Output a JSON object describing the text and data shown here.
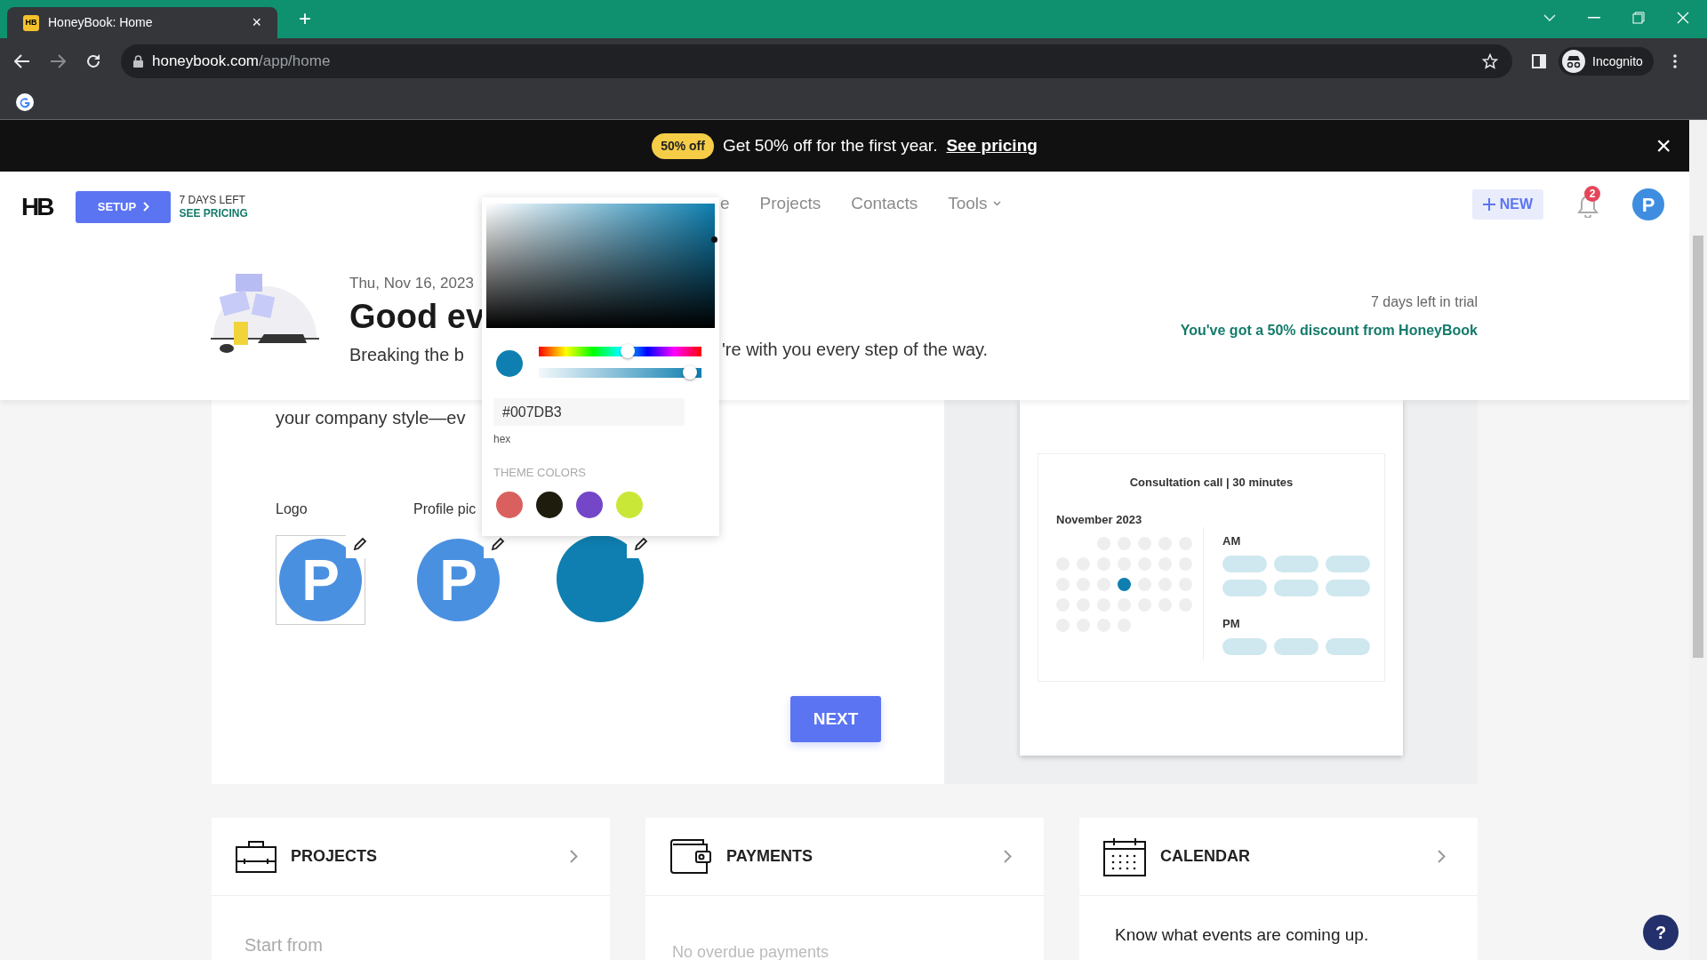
{
  "browser": {
    "favicon": "HB",
    "tab_title": "HoneyBook: Home",
    "tab_close": "×",
    "new_tab": "+",
    "url_domain": "honeybook.com",
    "url_path": "/app/home",
    "profile": "Incognito"
  },
  "promo_banner": {
    "badge": "50% off",
    "text": "Get 50% off for the first year.",
    "link": "See pricing",
    "close": "×"
  },
  "header": {
    "logo": "HB",
    "setup_button": "SETUP",
    "trial_days": "7 DAYS LEFT",
    "see_pricing": "SEE PRICING",
    "nav": [
      {
        "label": "e",
        "dropdown": false
      },
      {
        "label": "Projects",
        "dropdown": false
      },
      {
        "label": "Contacts",
        "dropdown": false
      },
      {
        "label": "Tools",
        "dropdown": true
      }
    ],
    "new_button": "NEW",
    "notification_count": "2",
    "avatar": "P"
  },
  "hero": {
    "date": "Thu, Nov 16, 2023",
    "greeting": "Good ev",
    "subtitle_start": "Breaking the b",
    "subtitle_end": "'re with you every step of the way.",
    "trial_note": "7 days left in trial",
    "discount": "You've got a 50% discount from HoneyBook"
  },
  "branding": {
    "intro": "your company style—ev",
    "next_button": "NEXT",
    "items": [
      {
        "kind": "image",
        "label": "Logo",
        "initial": "P"
      },
      {
        "kind": "image",
        "label": "Profile pic",
        "initial": "P"
      },
      {
        "kind": "color",
        "color": "#0e7fb0"
      }
    ]
  },
  "color_picker": {
    "preview": {
      "color": "#0e7fb0"
    },
    "hex": "#007DB3",
    "hex_label": "hex",
    "theme_title": "THEME COLORS",
    "sliders": [
      {
        "kind": "hue",
        "level": 0.55
      },
      {
        "kind": "alpha",
        "level": 0.97
      }
    ],
    "theme_colors": [
      {
        "color": "#d9605f"
      },
      {
        "color": "#1e1d0d"
      },
      {
        "color": "#7446c8"
      },
      {
        "color": "#c9e736"
      }
    ]
  },
  "booking_preview": {
    "title": "Consultation call | 30 minutes",
    "month": "November 2023",
    "am_label": "AM",
    "pm_label": "PM",
    "days": [
      {
        "kind": "blank"
      },
      {
        "kind": "blank"
      },
      {
        "kind": "day",
        "selected": false
      },
      {
        "kind": "day",
        "selected": false
      },
      {
        "kind": "day",
        "selected": false
      },
      {
        "kind": "day",
        "selected": false
      },
      {
        "kind": "day",
        "selected": false
      },
      {
        "kind": "day",
        "selected": false
      },
      {
        "kind": "day",
        "selected": false
      },
      {
        "kind": "day",
        "selected": false
      },
      {
        "kind": "day",
        "selected": false
      },
      {
        "kind": "day",
        "selected": false
      },
      {
        "kind": "day",
        "selected": false
      },
      {
        "kind": "day",
        "selected": false
      },
      {
        "kind": "day",
        "selected": false
      },
      {
        "kind": "day",
        "selected": false
      },
      {
        "kind": "day",
        "selected": false
      },
      {
        "kind": "day",
        "selected": true
      },
      {
        "kind": "day",
        "selected": false
      },
      {
        "kind": "day",
        "selected": false
      },
      {
        "kind": "day",
        "selected": false
      },
      {
        "kind": "day",
        "selected": false
      },
      {
        "kind": "day",
        "selected": false
      },
      {
        "kind": "day",
        "selected": false
      },
      {
        "kind": "day",
        "selected": false
      },
      {
        "kind": "day",
        "selected": false
      },
      {
        "kind": "day",
        "selected": false
      },
      {
        "kind": "day",
        "selected": false
      },
      {
        "kind": "day",
        "selected": false
      },
      {
        "kind": "day",
        "selected": false
      },
      {
        "kind": "day",
        "selected": false
      },
      {
        "kind": "day",
        "selected": false
      }
    ],
    "am_slots": [
      {
        "kind": "slot"
      },
      {
        "kind": "slot"
      },
      {
        "kind": "slot"
      },
      {
        "kind": "slot"
      },
      {
        "kind": "slot"
      },
      {
        "kind": "slot"
      }
    ],
    "pm_slots": [
      {
        "kind": "slot"
      },
      {
        "kind": "slot"
      },
      {
        "kind": "slot"
      }
    ]
  },
  "widgets": [
    {
      "kind": "projects",
      "title": "PROJECTS",
      "body": "Start from"
    },
    {
      "kind": "payments",
      "title": "PAYMENTS",
      "body": "No overdue payments"
    },
    {
      "kind": "calendar",
      "title": "CALENDAR",
      "body": "Know what events are coming up."
    }
  ],
  "help_button": "?"
}
